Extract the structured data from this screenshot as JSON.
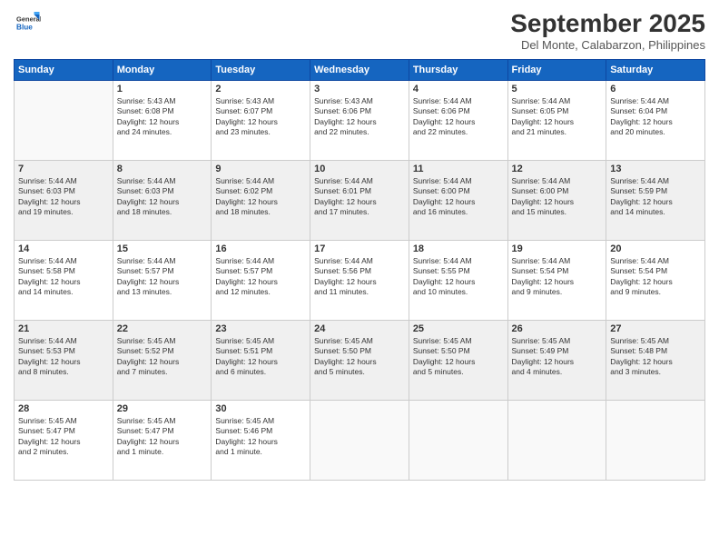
{
  "header": {
    "logo": {
      "general": "General",
      "blue": "Blue"
    },
    "title": "September 2025",
    "location": "Del Monte, Calabarzon, Philippines"
  },
  "weekdays": [
    "Sunday",
    "Monday",
    "Tuesday",
    "Wednesday",
    "Thursday",
    "Friday",
    "Saturday"
  ],
  "weeks": [
    [
      {
        "day": "",
        "info": ""
      },
      {
        "day": "1",
        "info": "Sunrise: 5:43 AM\nSunset: 6:08 PM\nDaylight: 12 hours\nand 24 minutes."
      },
      {
        "day": "2",
        "info": "Sunrise: 5:43 AM\nSunset: 6:07 PM\nDaylight: 12 hours\nand 23 minutes."
      },
      {
        "day": "3",
        "info": "Sunrise: 5:43 AM\nSunset: 6:06 PM\nDaylight: 12 hours\nand 22 minutes."
      },
      {
        "day": "4",
        "info": "Sunrise: 5:44 AM\nSunset: 6:06 PM\nDaylight: 12 hours\nand 22 minutes."
      },
      {
        "day": "5",
        "info": "Sunrise: 5:44 AM\nSunset: 6:05 PM\nDaylight: 12 hours\nand 21 minutes."
      },
      {
        "day": "6",
        "info": "Sunrise: 5:44 AM\nSunset: 6:04 PM\nDaylight: 12 hours\nand 20 minutes."
      }
    ],
    [
      {
        "day": "7",
        "info": "Sunrise: 5:44 AM\nSunset: 6:03 PM\nDaylight: 12 hours\nand 19 minutes."
      },
      {
        "day": "8",
        "info": "Sunrise: 5:44 AM\nSunset: 6:03 PM\nDaylight: 12 hours\nand 18 minutes."
      },
      {
        "day": "9",
        "info": "Sunrise: 5:44 AM\nSunset: 6:02 PM\nDaylight: 12 hours\nand 18 minutes."
      },
      {
        "day": "10",
        "info": "Sunrise: 5:44 AM\nSunset: 6:01 PM\nDaylight: 12 hours\nand 17 minutes."
      },
      {
        "day": "11",
        "info": "Sunrise: 5:44 AM\nSunset: 6:00 PM\nDaylight: 12 hours\nand 16 minutes."
      },
      {
        "day": "12",
        "info": "Sunrise: 5:44 AM\nSunset: 6:00 PM\nDaylight: 12 hours\nand 15 minutes."
      },
      {
        "day": "13",
        "info": "Sunrise: 5:44 AM\nSunset: 5:59 PM\nDaylight: 12 hours\nand 14 minutes."
      }
    ],
    [
      {
        "day": "14",
        "info": "Sunrise: 5:44 AM\nSunset: 5:58 PM\nDaylight: 12 hours\nand 14 minutes."
      },
      {
        "day": "15",
        "info": "Sunrise: 5:44 AM\nSunset: 5:57 PM\nDaylight: 12 hours\nand 13 minutes."
      },
      {
        "day": "16",
        "info": "Sunrise: 5:44 AM\nSunset: 5:57 PM\nDaylight: 12 hours\nand 12 minutes."
      },
      {
        "day": "17",
        "info": "Sunrise: 5:44 AM\nSunset: 5:56 PM\nDaylight: 12 hours\nand 11 minutes."
      },
      {
        "day": "18",
        "info": "Sunrise: 5:44 AM\nSunset: 5:55 PM\nDaylight: 12 hours\nand 10 minutes."
      },
      {
        "day": "19",
        "info": "Sunrise: 5:44 AM\nSunset: 5:54 PM\nDaylight: 12 hours\nand 9 minutes."
      },
      {
        "day": "20",
        "info": "Sunrise: 5:44 AM\nSunset: 5:54 PM\nDaylight: 12 hours\nand 9 minutes."
      }
    ],
    [
      {
        "day": "21",
        "info": "Sunrise: 5:44 AM\nSunset: 5:53 PM\nDaylight: 12 hours\nand 8 minutes."
      },
      {
        "day": "22",
        "info": "Sunrise: 5:45 AM\nSunset: 5:52 PM\nDaylight: 12 hours\nand 7 minutes."
      },
      {
        "day": "23",
        "info": "Sunrise: 5:45 AM\nSunset: 5:51 PM\nDaylight: 12 hours\nand 6 minutes."
      },
      {
        "day": "24",
        "info": "Sunrise: 5:45 AM\nSunset: 5:50 PM\nDaylight: 12 hours\nand 5 minutes."
      },
      {
        "day": "25",
        "info": "Sunrise: 5:45 AM\nSunset: 5:50 PM\nDaylight: 12 hours\nand 5 minutes."
      },
      {
        "day": "26",
        "info": "Sunrise: 5:45 AM\nSunset: 5:49 PM\nDaylight: 12 hours\nand 4 minutes."
      },
      {
        "day": "27",
        "info": "Sunrise: 5:45 AM\nSunset: 5:48 PM\nDaylight: 12 hours\nand 3 minutes."
      }
    ],
    [
      {
        "day": "28",
        "info": "Sunrise: 5:45 AM\nSunset: 5:47 PM\nDaylight: 12 hours\nand 2 minutes."
      },
      {
        "day": "29",
        "info": "Sunrise: 5:45 AM\nSunset: 5:47 PM\nDaylight: 12 hours\nand 1 minute."
      },
      {
        "day": "30",
        "info": "Sunrise: 5:45 AM\nSunset: 5:46 PM\nDaylight: 12 hours\nand 1 minute."
      },
      {
        "day": "",
        "info": ""
      },
      {
        "day": "",
        "info": ""
      },
      {
        "day": "",
        "info": ""
      },
      {
        "day": "",
        "info": ""
      }
    ]
  ]
}
